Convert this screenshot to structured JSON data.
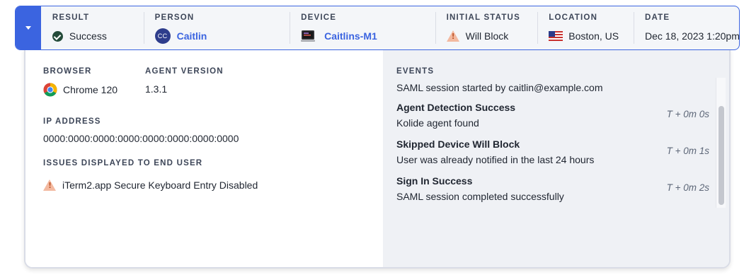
{
  "header": {
    "result": {
      "label": "RESULT",
      "value": "Success",
      "icon": "check-circle-icon"
    },
    "person": {
      "label": "PERSON",
      "initials": "CC",
      "name": "Caitlin"
    },
    "device": {
      "label": "DEVICE",
      "name": "Caitlins-M1",
      "icon": "laptop-icon"
    },
    "initial_status": {
      "label": "INITIAL STATUS",
      "value": "Will Block",
      "icon": "warning-icon"
    },
    "location": {
      "label": "LOCATION",
      "value": "Boston, US",
      "icon": "us-flag-icon"
    },
    "date": {
      "label": "DATE",
      "value": "Dec 18, 2023 1:20pm"
    }
  },
  "details": {
    "browser": {
      "label": "BROWSER",
      "value": "Chrome 120",
      "icon": "chrome-icon"
    },
    "agent_version": {
      "label": "AGENT VERSION",
      "value": "1.3.1"
    },
    "ip_address": {
      "label": "IP ADDRESS",
      "value": "0000:0000:0000:0000:0000:0000:0000:0000"
    },
    "issues": {
      "label": "ISSUES DISPLAYED TO END USER",
      "items": [
        {
          "text": "iTerm2.app Secure Keyboard Entry Disabled",
          "icon": "warning-icon"
        }
      ]
    }
  },
  "events": {
    "label": "EVENTS",
    "partial_first": "SAML session started by caitlin@example.com",
    "items": [
      {
        "title": "Agent Detection Success",
        "description": "Kolide agent found",
        "time": "T + 0m 0s"
      },
      {
        "title": "Skipped Device Will Block",
        "description": "User was already notified in the last 24 hours",
        "time": "T + 0m 1s"
      },
      {
        "title": "Sign In Success",
        "description": "SAML session completed successfully",
        "time": "T + 0m 2s"
      }
    ]
  },
  "colors": {
    "accent": "#3b64e0",
    "success": "#244b3a",
    "warning": "#f3b9a0",
    "events_bg": "#eff1f5"
  }
}
